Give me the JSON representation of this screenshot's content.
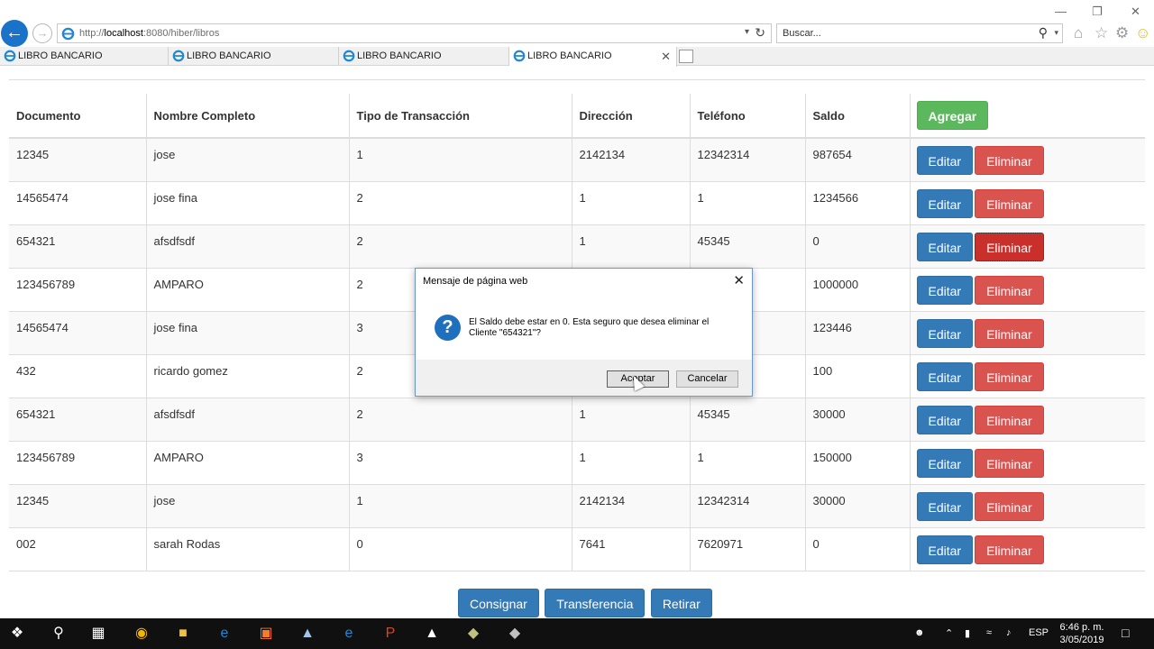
{
  "browser": {
    "address": {
      "prefix": "http://",
      "host": "localhost",
      "rest": ":8080/hiber/libros"
    },
    "search_placeholder": "Buscar...",
    "tabs": [
      {
        "label": "LIBRO BANCARIO"
      },
      {
        "label": "LIBRO BANCARIO"
      },
      {
        "label": "LIBRO BANCARIO"
      },
      {
        "label": "LIBRO BANCARIO"
      }
    ]
  },
  "table": {
    "headers": [
      "Documento",
      "Nombre Completo",
      "Tipo de Transacción",
      "Dirección",
      "Teléfono",
      "Saldo"
    ],
    "add_label": "Agregar",
    "edit_label": "Editar",
    "delete_label": "Eliminar",
    "rows": [
      [
        "12345",
        "jose",
        "1",
        "2142134",
        "12342314",
        "987654"
      ],
      [
        "14565474",
        "jose fina",
        "2",
        "1",
        "1",
        "1234566"
      ],
      [
        "654321",
        "afsdfsdf",
        "2",
        "1",
        "45345",
        "0"
      ],
      [
        "123456789",
        "AMPARO",
        "2",
        "",
        "",
        "1000000"
      ],
      [
        "14565474",
        "jose fina",
        "3",
        "",
        "",
        "123446"
      ],
      [
        "432",
        "ricardo gomez",
        "2",
        "",
        "",
        "100"
      ],
      [
        "654321",
        "afsdfsdf",
        "2",
        "1",
        "45345",
        "30000"
      ],
      [
        "123456789",
        "AMPARO",
        "3",
        "1",
        "1",
        "150000"
      ],
      [
        "12345",
        "jose",
        "1",
        "2142134",
        "12342314",
        "30000"
      ],
      [
        "002",
        "sarah Rodas",
        "0",
        "7641",
        "7620971",
        "0"
      ]
    ]
  },
  "bottom": {
    "consignar": "Consignar",
    "transferencia": "Transferencia",
    "retirar": "Retirar"
  },
  "dialog": {
    "title": "Mensaje de página web",
    "message": "El Saldo debe estar en 0. Esta seguro que desea eliminar el Cliente \"654321\"?",
    "ok": "Aceptar",
    "cancel": "Cancelar"
  },
  "taskbar": {
    "lang": "ESP",
    "time": "6:46 p. m.",
    "date": "3/05/2019"
  }
}
